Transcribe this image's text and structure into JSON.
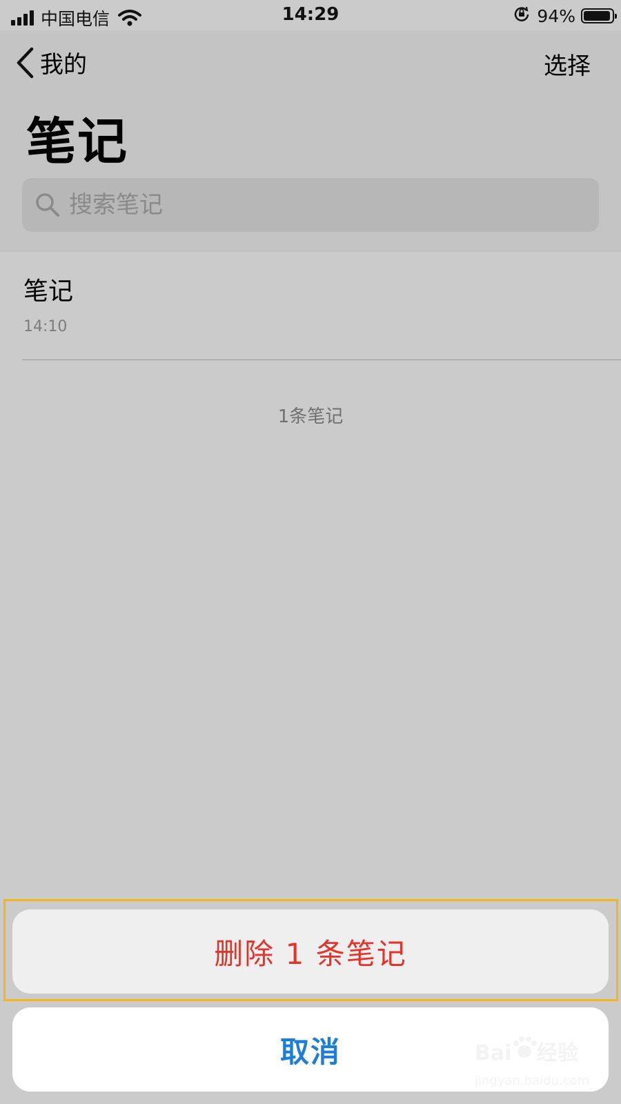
{
  "status_bar": {
    "carrier": "中国电信",
    "time": "14:29",
    "battery_percent": "94%",
    "battery_level": 0.94,
    "signal_bars": 4,
    "icons": [
      "signal-icon",
      "wifi-icon",
      "lock-rotation-icon",
      "battery-icon"
    ]
  },
  "nav": {
    "back_label": "我的",
    "select_label": "选择"
  },
  "page": {
    "title": "笔记"
  },
  "search": {
    "placeholder": "搜索笔记"
  },
  "notes": [
    {
      "title": "笔记",
      "time": "14:10"
    }
  ],
  "notes_count": "1条笔记",
  "action_sheet": {
    "delete_label": "删除 1 条笔记",
    "cancel_label": "取消"
  },
  "colors": {
    "delete": "#e3342c",
    "cancel": "#1c7ed6",
    "highlight": "#f3b618"
  },
  "watermark": {
    "brand": "Baidu经验",
    "url": "jingyan.baidu.com"
  }
}
